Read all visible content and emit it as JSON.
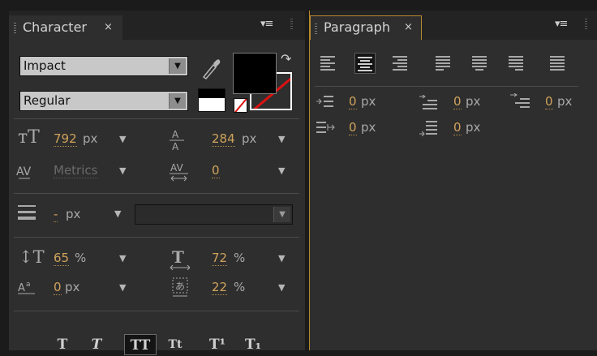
{
  "character": {
    "tab_label": "Character",
    "close_glyph": "×",
    "menu_glyph": "▾≡",
    "font_family": "Impact",
    "font_style": "Regular",
    "fill_color": "#000000",
    "stroke_color": "none",
    "font_size": {
      "value": "792",
      "unit": "px"
    },
    "leading": {
      "value": "284",
      "unit": "px"
    },
    "kerning": {
      "value": "Metrics"
    },
    "tracking": {
      "value": "0"
    },
    "stroke_width": {
      "value": "-",
      "unit": "px"
    },
    "stroke_style": "",
    "vertical_scale": {
      "value": "65",
      "unit": "%"
    },
    "horizontal_scale": {
      "value": "72",
      "unit": "%"
    },
    "baseline_shift": {
      "value": "0",
      "unit": "px"
    },
    "tsume": {
      "value": "22",
      "unit": "%"
    },
    "style_buttons": [
      "T",
      "T",
      "TT",
      "Tt",
      "T¹",
      "T₁"
    ]
  },
  "paragraph": {
    "tab_label": "Paragraph",
    "close_glyph": "×",
    "menu_glyph": "▾≡",
    "indent_left": {
      "value": "0",
      "unit": "px"
    },
    "indent_first_line": {
      "value": "0",
      "unit": "px"
    },
    "indent_right": {
      "value": "0",
      "unit": "px"
    },
    "space_before": {
      "value": "0",
      "unit": "px"
    },
    "space_after": {
      "value": "0",
      "unit": "px"
    }
  },
  "colors": {
    "accent": "#d0a35b",
    "panel": "#2e2e2e",
    "active_border": "#b7892b"
  }
}
